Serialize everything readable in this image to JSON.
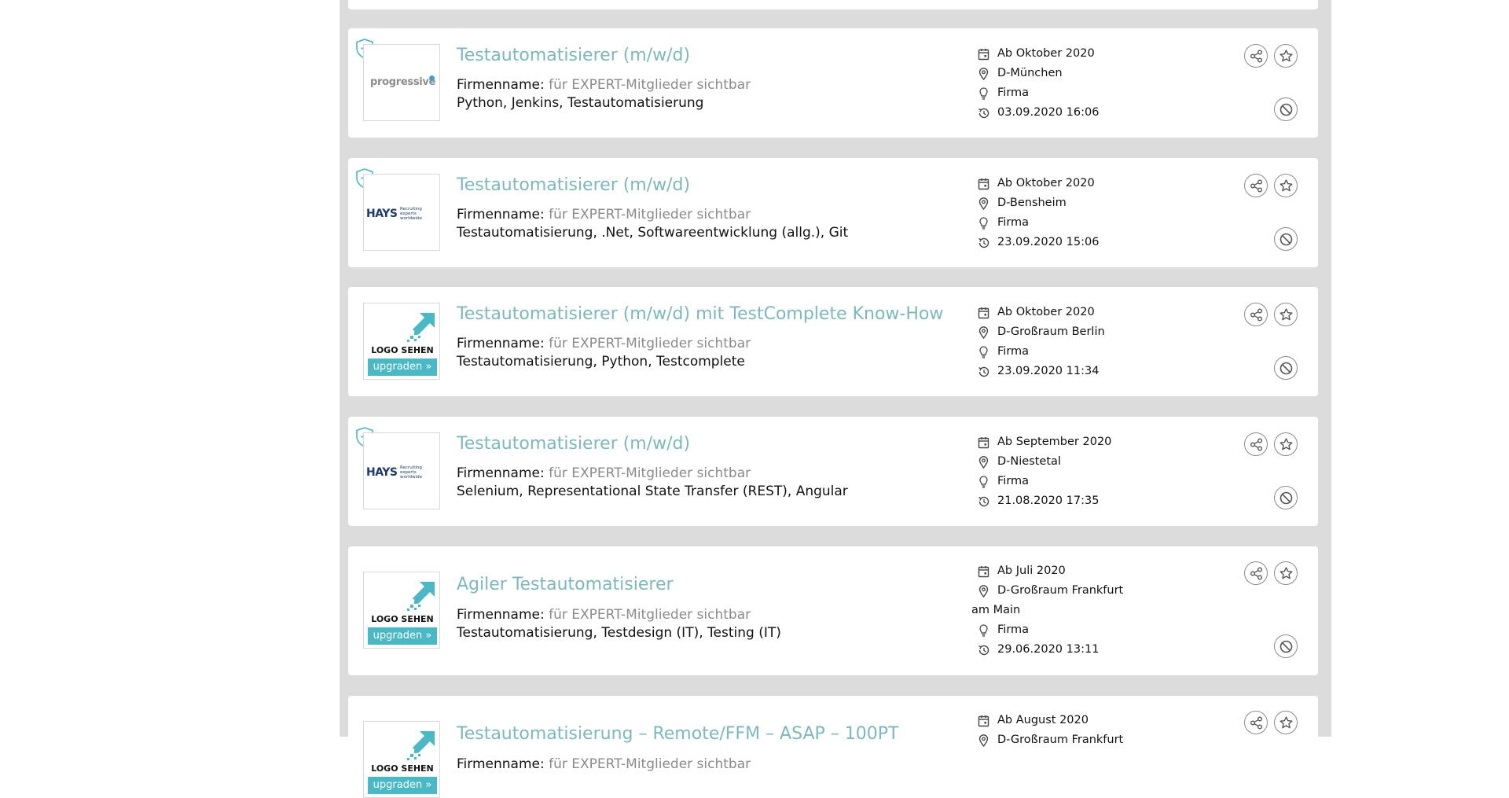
{
  "jobs": [
    {
      "title": "Testautomatisierer (m/w/d)",
      "logo": "progressive",
      "logo_text": "progressive",
      "expert": true,
      "firm_label": "Firmenname:",
      "firm_value": "für EXPERT-Mitglieder sichtbar",
      "skills": "Python, Jenkins, Testautomatisierung",
      "start": "Ab Oktober 2020",
      "location": "D-München",
      "location_cont": "",
      "type": "Firma",
      "date": "03.09.2020 16:06"
    },
    {
      "title": "Testautomatisierer (m/w/d)",
      "logo": "hays",
      "logo_text": "HAYS",
      "logo_sub": "Recruiting experts worldwide",
      "expert": true,
      "firm_label": "Firmenname:",
      "firm_value": "für EXPERT-Mitglieder sichtbar",
      "skills": "Testautomatisierung, .Net, Softwareentwicklung (allg.), Git",
      "start": "Ab Oktober 2020",
      "location": "D-Bensheim",
      "location_cont": "",
      "type": "Firma",
      "date": "23.09.2020 15:06"
    },
    {
      "title": "Testautomatisierer (m/w/d) mit TestComplete Know-How",
      "logo": "sehen",
      "logo_text": "LOGO SEHEN",
      "logo_button": "upgraden »",
      "expert": false,
      "firm_label": "Firmenname:",
      "firm_value": "für EXPERT-Mitglieder sichtbar",
      "skills": "Testautomatisierung, Python, Testcomplete",
      "start": "Ab Oktober 2020",
      "location": "D-Großraum Berlin",
      "location_cont": "",
      "type": "Firma",
      "date": "23.09.2020 11:34"
    },
    {
      "title": "Testautomatisierer (m/w/d)",
      "logo": "hays",
      "logo_text": "HAYS",
      "logo_sub": "Recruiting experts worldwide",
      "expert": true,
      "firm_label": "Firmenname:",
      "firm_value": "für EXPERT-Mitglieder sichtbar",
      "skills": "Selenium, Representational State Transfer (REST), Angular",
      "start": "Ab September 2020",
      "location": "D-Niestetal",
      "location_cont": "",
      "type": "Firma",
      "date": "21.08.2020 17:35"
    },
    {
      "title": "Agiler Testautomatisierer",
      "logo": "sehen",
      "logo_text": "LOGO SEHEN",
      "logo_button": "upgraden »",
      "expert": false,
      "firm_label": "Firmenname:",
      "firm_value": "für EXPERT-Mitglieder sichtbar",
      "skills": "Testautomatisierung, Testdesign (IT), Testing (IT)",
      "start": "Ab Juli 2020",
      "location": "D-Großraum Frankfurt",
      "location_cont": "am Main",
      "type": "Firma",
      "date": "29.06.2020 13:11"
    },
    {
      "title": "Testautomatisierung – Remote/FFM – ASAP – 100PT",
      "logo": "sehen",
      "logo_text": "LOGO SEHEN",
      "logo_button": "upgraden »",
      "expert": false,
      "firm_label": "Firmenname:",
      "firm_value": "für EXPERT-Mitglieder sichtbar",
      "skills": "",
      "start": "Ab August 2020",
      "location": "D-Großraum Frankfurt",
      "location_cont": "",
      "type": "",
      "date": ""
    }
  ],
  "icons": {
    "expert": "shield-plus-icon",
    "start": "calendar-icon",
    "location": "map-pin-icon",
    "type": "lightbulb-icon",
    "date": "history-icon",
    "share": "share-icon",
    "favorite": "star-icon",
    "hide": "block-icon"
  },
  "colors": {
    "title": "#7bb9bd",
    "accent": "#49b9c5",
    "background": "#dcdcdc"
  }
}
